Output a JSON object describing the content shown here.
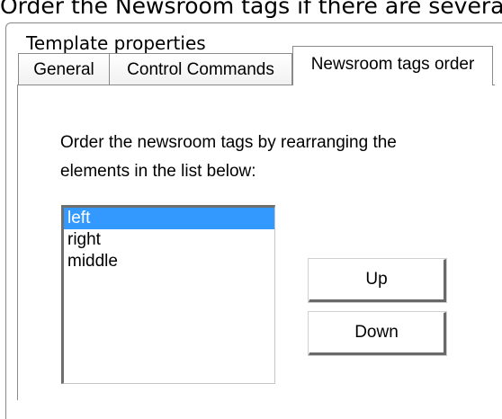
{
  "page_caption": "Order the Newsroom tags if there are several",
  "dialog": {
    "title": "Template properties",
    "tabs": [
      {
        "label": "General"
      },
      {
        "label": "Control Commands"
      },
      {
        "label": "Newsroom tags order"
      }
    ],
    "active_tab": "Newsroom tags order",
    "instruction_line1": "Order the newsroom tags by rearranging the",
    "instruction_line2": "elements in the list below:",
    "list": {
      "items": [
        "left",
        "right",
        "middle"
      ],
      "selected": "left"
    },
    "buttons": {
      "up_label": "Up",
      "down_label": "Down"
    }
  },
  "colors": {
    "selection": "#3399ff",
    "text": "#000000",
    "border": "#8a8a8a"
  }
}
